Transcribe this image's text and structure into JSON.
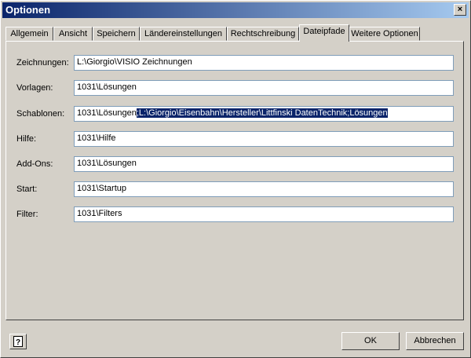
{
  "window": {
    "title": "Optionen",
    "close_label": "×"
  },
  "tabs": [
    {
      "label": "Allgemein"
    },
    {
      "label": "Ansicht"
    },
    {
      "label": "Speichern"
    },
    {
      "label": "Ländereinstellungen"
    },
    {
      "label": "Rechtschreibung"
    },
    {
      "label": "Dateipfade"
    },
    {
      "label": "Weitere Optionen"
    }
  ],
  "fields": [
    {
      "label": "Zeichnungen:",
      "value": "L:\\Giorgio\\VISIO Zeichnungen"
    },
    {
      "label": "Vorlagen:",
      "value": "1031\\Lösungen"
    },
    {
      "label": "Schablonen:",
      "value_plain": "1031\\Lösungen",
      "value_selected": ";L:\\Giorgio\\Eisenbahn\\Hersteller\\Littfinski DatenTechnik;Lösungen"
    },
    {
      "label": "Hilfe:",
      "value": "1031\\Hilfe"
    },
    {
      "label": "Add-Ons:",
      "value": "1031\\Lösungen"
    },
    {
      "label": "Start:",
      "value": "1031\\Startup"
    },
    {
      "label": "Filter:",
      "value": "1031\\Filters"
    }
  ],
  "buttons": {
    "ok": "OK",
    "cancel": "Abbrechen"
  }
}
